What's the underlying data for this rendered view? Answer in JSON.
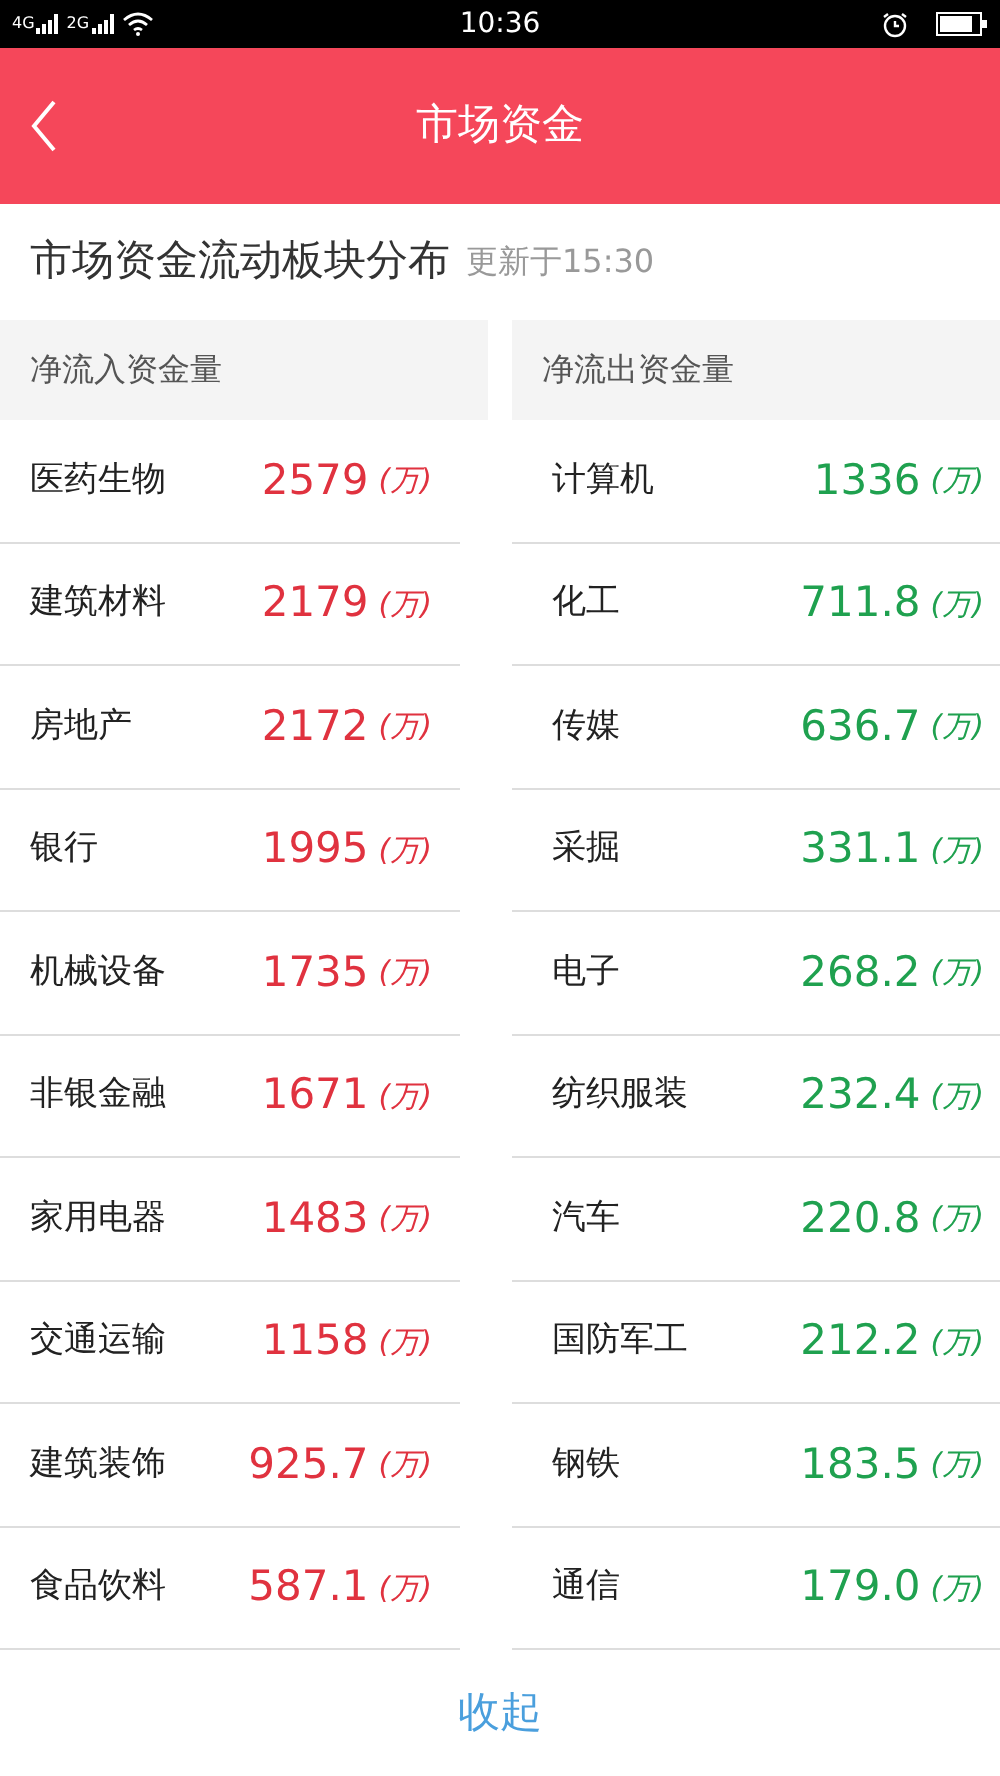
{
  "status_bar": {
    "networks": [
      "4G",
      "2G"
    ],
    "time": "10:36"
  },
  "header": {
    "title": "市场资金"
  },
  "section": {
    "title": "市场资金流动板块分布",
    "updated": "更新于15:30"
  },
  "columns": [
    {
      "kind": "inflow",
      "heading": "净流入资金量",
      "rows": [
        {
          "name": "医药生物",
          "value": "2579",
          "unit": "(万)"
        },
        {
          "name": "建筑材料",
          "value": "2179",
          "unit": "(万)"
        },
        {
          "name": "房地产",
          "value": "2172",
          "unit": "(万)"
        },
        {
          "name": "银行",
          "value": "1995",
          "unit": "(万)"
        },
        {
          "name": "机械设备",
          "value": "1735",
          "unit": "(万)"
        },
        {
          "name": "非银金融",
          "value": "1671",
          "unit": "(万)"
        },
        {
          "name": "家用电器",
          "value": "1483",
          "unit": "(万)"
        },
        {
          "name": "交通运输",
          "value": "1158",
          "unit": "(万)"
        },
        {
          "name": "建筑装饰",
          "value": "925.7",
          "unit": "(万)"
        },
        {
          "name": "食品饮料",
          "value": "587.1",
          "unit": "(万)"
        }
      ]
    },
    {
      "kind": "outflow",
      "heading": "净流出资金量",
      "rows": [
        {
          "name": "计算机",
          "value": "1336",
          "unit": "(万)"
        },
        {
          "name": "化工",
          "value": "711.8",
          "unit": "(万)"
        },
        {
          "name": "传媒",
          "value": "636.7",
          "unit": "(万)"
        },
        {
          "name": "采掘",
          "value": "331.1",
          "unit": "(万)"
        },
        {
          "name": "电子",
          "value": "268.2",
          "unit": "(万)"
        },
        {
          "name": "纺织服装",
          "value": "232.4",
          "unit": "(万)"
        },
        {
          "name": "汽车",
          "value": "220.8",
          "unit": "(万)"
        },
        {
          "name": "国防军工",
          "value": "212.2",
          "unit": "(万)"
        },
        {
          "name": "钢铁",
          "value": "183.5",
          "unit": "(万)"
        },
        {
          "name": "通信",
          "value": "179.0",
          "unit": "(万)"
        }
      ]
    }
  ],
  "footer": {
    "collapse": "收起"
  }
}
